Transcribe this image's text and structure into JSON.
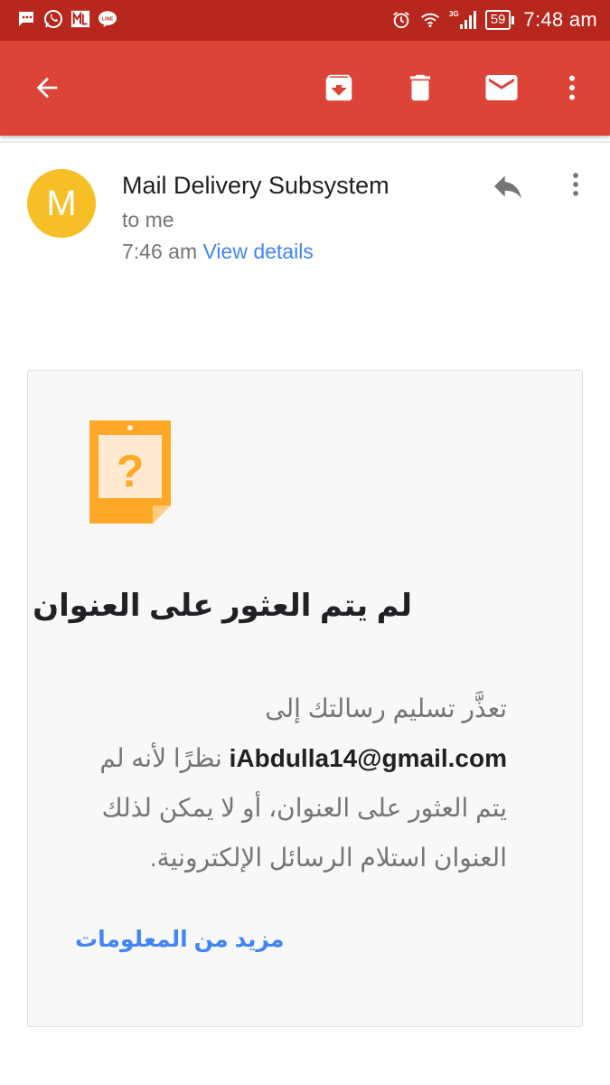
{
  "status_bar": {
    "time": "7:48 am",
    "battery": "59",
    "network": "3G",
    "apps": [
      "chat-notification-icon",
      "whatsapp-icon",
      "ml-icon",
      "line-icon"
    ]
  },
  "toolbar": {
    "icons": [
      "back-arrow-icon",
      "archive-icon",
      "delete-icon",
      "mark-unread-icon",
      "more-vert-icon"
    ]
  },
  "message": {
    "avatar_letter": "M",
    "sender": "Mail Delivery Subsystem",
    "to": "to me",
    "time": "7:46 am",
    "view_details": "View details"
  },
  "card": {
    "title": "لم يتم العثور على العنوان",
    "body_before": "تعذَّر تسليم رسالتك إلى ",
    "email": "iAbdulla14@gmail.com",
    "body_after": " نظرًا لأنه لم يتم العثور على العنوان، أو لا يمكن لذلك العنوان استلام الرسائل الإلكترونية.",
    "link": "مزيد من المعلومات"
  },
  "colors": {
    "status_bar": "#b8271d",
    "toolbar": "#db4437",
    "avatar": "#f6bf26",
    "link": "#4285f4",
    "note_icon": "#ffa726"
  }
}
